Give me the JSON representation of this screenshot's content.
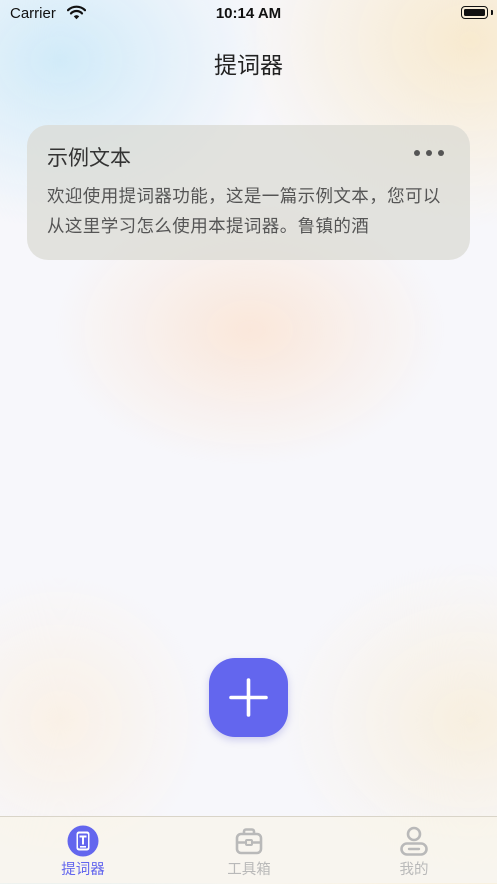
{
  "status_bar": {
    "carrier": "Carrier",
    "time": "10:14 AM"
  },
  "nav": {
    "title": "提词器"
  },
  "documents": [
    {
      "title": "示例文本",
      "preview": "欢迎使用提词器功能，这是一篇示例文本，您可以从这里学习怎么使用本提词器。鲁镇的酒",
      "more_icon": "ellipsis-icon"
    }
  ],
  "fab": {
    "icon": "plus-icon"
  },
  "tab_bar": {
    "tabs": [
      {
        "label": "提词器",
        "icon": "teleprompter-icon",
        "active": true
      },
      {
        "label": "工具箱",
        "icon": "toolbox-icon",
        "active": false
      },
      {
        "label": "我的",
        "icon": "profile-icon",
        "active": false
      }
    ]
  },
  "colors": {
    "accent": "#6366ee",
    "inactive_tab": "#b9b9b9",
    "card_background": "#dadad2"
  }
}
